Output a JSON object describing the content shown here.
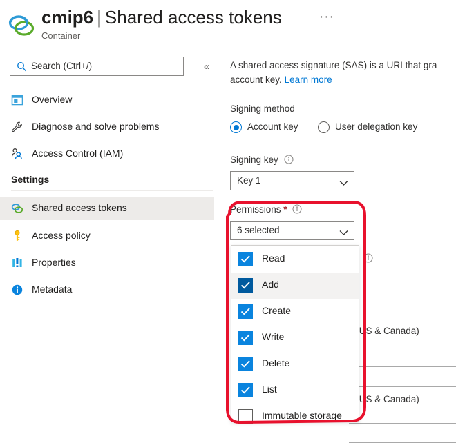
{
  "header": {
    "resource_name": "cmip6",
    "separator": "|",
    "page_name": "Shared access tokens",
    "subtitle": "Container",
    "ellipsis_label": "···",
    "icon": "container-icon"
  },
  "sidebar": {
    "search": {
      "placeholder": "Search (Ctrl+/)",
      "value": "",
      "icon": "search-icon"
    },
    "collapse_label": "«",
    "items": [
      {
        "label": "Overview",
        "icon": "overview-icon",
        "selected": false
      },
      {
        "label": "Diagnose and solve problems",
        "icon": "wrench-icon",
        "selected": false
      },
      {
        "label": "Access Control (IAM)",
        "icon": "users-icon",
        "selected": false
      }
    ],
    "group_label": "Settings",
    "settings_items": [
      {
        "label": "Shared access tokens",
        "icon": "container-icon",
        "selected": true
      },
      {
        "label": "Access policy",
        "icon": "key-icon",
        "selected": false
      },
      {
        "label": "Properties",
        "icon": "properties-icon",
        "selected": false
      },
      {
        "label": "Metadata",
        "icon": "info-circle-icon",
        "selected": false
      }
    ]
  },
  "main": {
    "description": {
      "text": "A shared access signature (SAS) is a URI that gra",
      "text_line2": "account key.",
      "link_label": "Learn more"
    },
    "signing_method": {
      "label": "Signing method",
      "options": [
        {
          "label": "Account key",
          "checked": true
        },
        {
          "label": "User delegation key",
          "checked": false
        }
      ]
    },
    "signing_key": {
      "label": "Signing key",
      "info_icon": "info-icon",
      "value": "Key 1",
      "chevron": "chevron-down-icon"
    },
    "permissions": {
      "label": "Permissions",
      "required_marker": "*",
      "info_icon": "info-icon",
      "value": "6 selected",
      "chevron": "chevron-down-icon",
      "options": [
        {
          "label": "Read",
          "checked": true,
          "hover": false
        },
        {
          "label": "Add",
          "checked": true,
          "hover": true
        },
        {
          "label": "Create",
          "checked": true,
          "hover": false
        },
        {
          "label": "Write",
          "checked": true,
          "hover": false
        },
        {
          "label": "Delete",
          "checked": true,
          "hover": false
        },
        {
          "label": "List",
          "checked": true,
          "hover": false
        },
        {
          "label": "Immutable storage",
          "checked": false,
          "hover": false
        }
      ]
    },
    "background_form": {
      "info_icon": "info-icon",
      "timezone_value_1": "e (US & Canada)",
      "timezone_value_2": "e (US & Canada)"
    }
  },
  "annotation": {
    "shape": "rounded-rectangle-highlight",
    "color": "#e8112d",
    "stroke_width": 4
  },
  "colors": {
    "accent": "#0078d4",
    "checkbox_blue": "#0a84de",
    "checkbox_blue_hover": "#005a9e",
    "link": "#0078d4",
    "required_red": "#a4262c",
    "annotation_red": "#e8112d",
    "selected_row": "#edebe9",
    "border": "#8a8886"
  }
}
